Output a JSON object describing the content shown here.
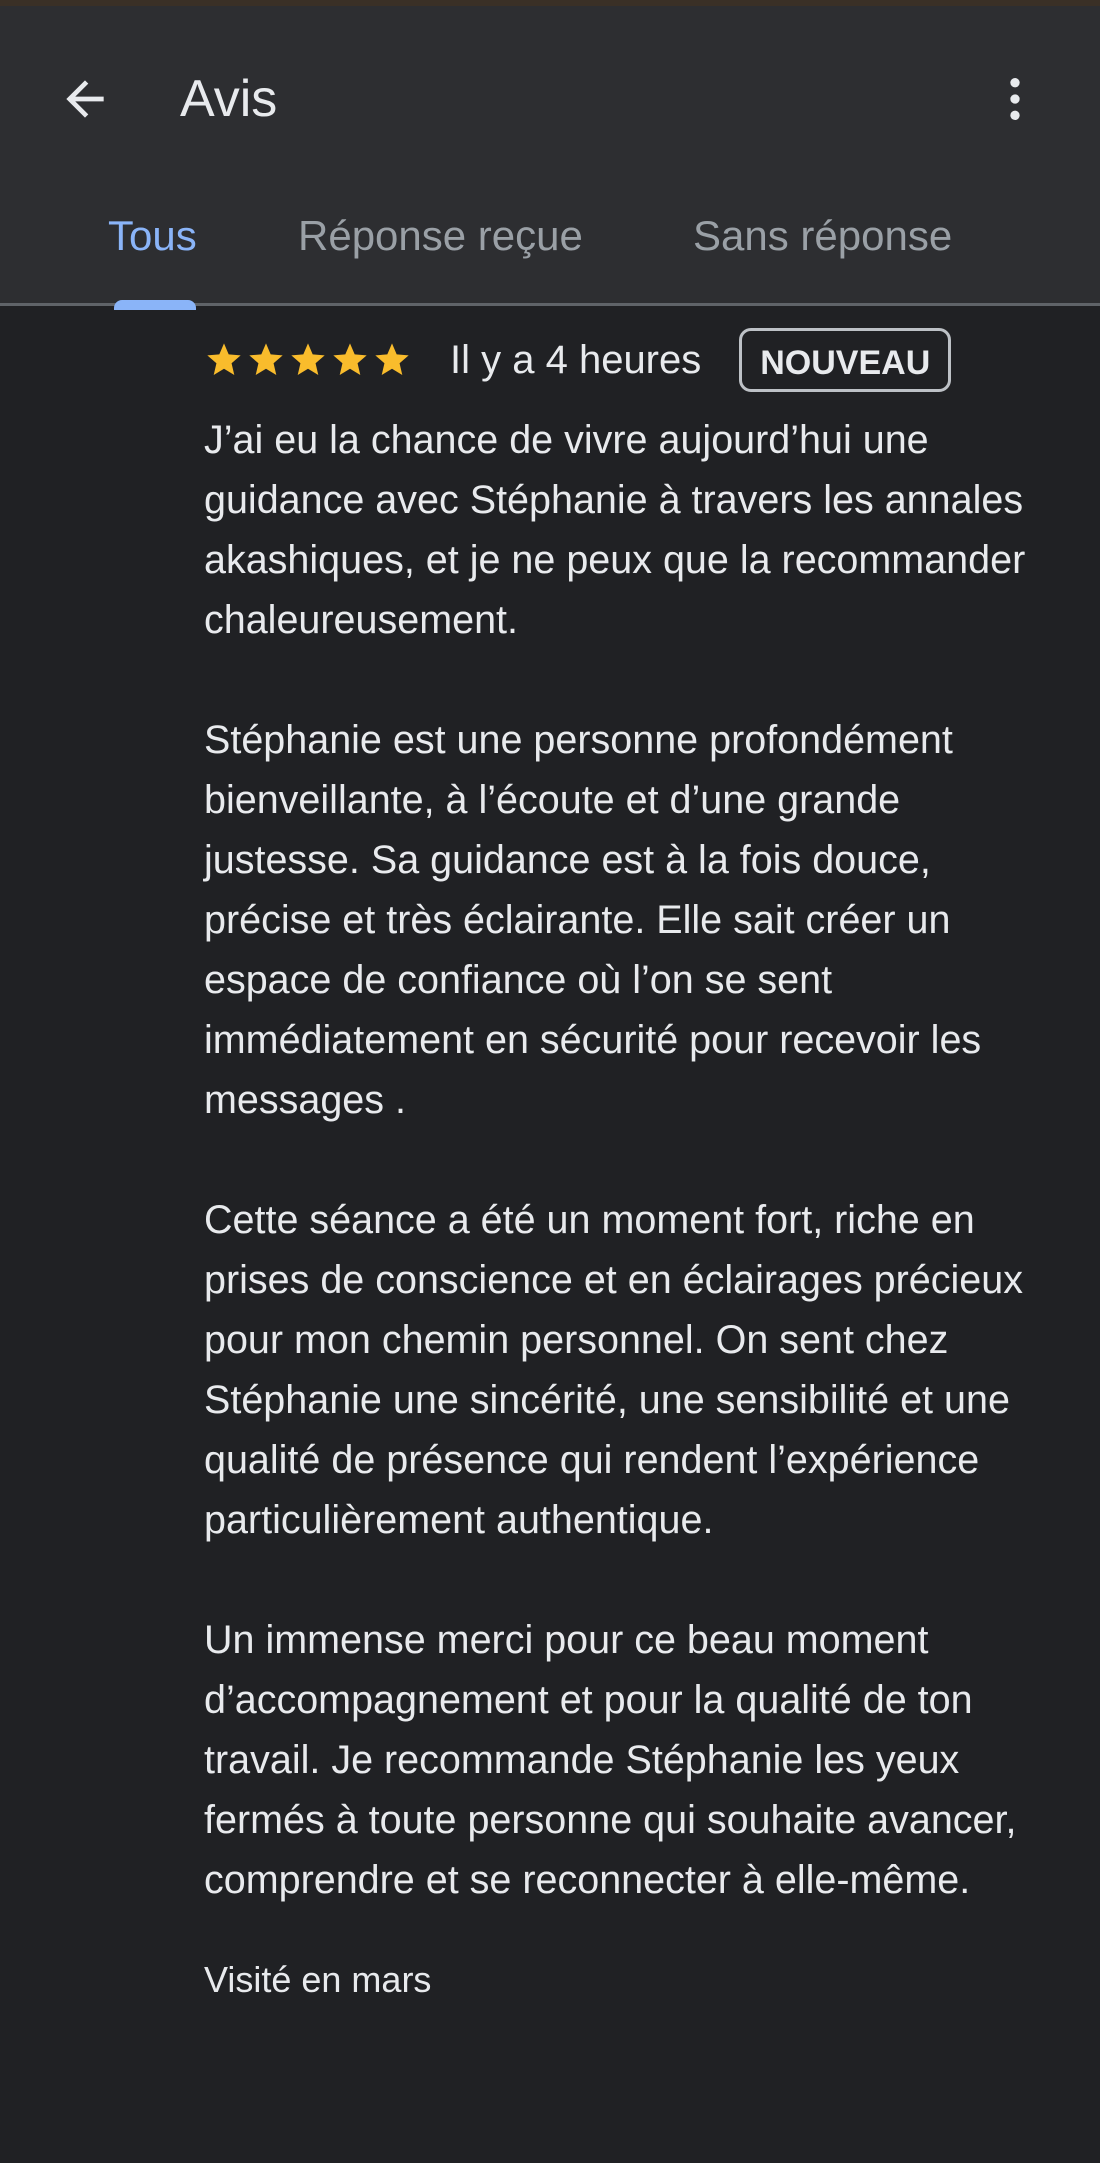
{
  "header": {
    "title": "Avis",
    "back_icon": "arrow-back-icon",
    "more_icon": "more-vert-icon"
  },
  "tabs": [
    {
      "label": "Tous",
      "active": true
    },
    {
      "label": "Réponse reçue",
      "active": false
    },
    {
      "label": "Sans réponse",
      "active": false
    }
  ],
  "review": {
    "rating": 5,
    "max_rating": 5,
    "time": "Il y a 4 heures",
    "badge": "NOUVEAU",
    "paragraphs": [
      "J’ai eu la chance de vivre aujourd’hui une guidance avec Stéphanie à travers les annales akashiques, et je ne peux que la recommander chaleureusement.",
      "Stéphanie est une personne profondément bienveillante, à l’écoute et d’une grande justesse. Sa guidance est à la fois douce, précise et très éclairante. Elle sait créer un espace de confiance où l’on se sent immédiatement en sécurité pour recevoir les messages .",
      "Cette séance a été un moment fort, riche en prises de conscience et en éclairages précieux pour mon chemin personnel. On sent chez Stéphanie une sincérité, une sensibilité et une qualité de présence qui rendent l’expérience particulièrement authentique.",
      "Un immense merci pour ce beau moment d’accompagnement et pour la qualité de ton travail. Je recommande Stéphanie les yeux fermés à toute personne qui souhaite avancer, comprendre et se reconnecter à elle-même."
    ],
    "visited": "Visité en mars"
  },
  "colors": {
    "background": "#202124",
    "app_bar": "#2d2e31",
    "accent": "#8ab4f8",
    "star": "#f9bc2c",
    "text": "#e8eaed",
    "muted": "#9aa0a6"
  }
}
